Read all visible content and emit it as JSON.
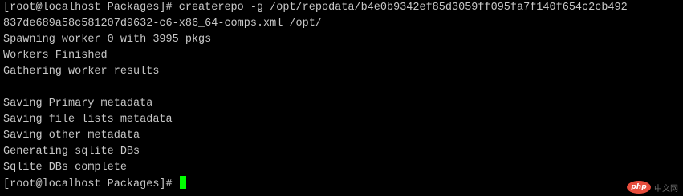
{
  "terminal": {
    "line1": "[root@localhost Packages]# createrepo -g /opt/repodata/b4e0b9342ef85d3059ff095fa7f140f654c2cb492",
    "line2": "837de689a58c581207d9632-c6-x86_64-comps.xml /opt/",
    "line3": "Spawning worker 0 with 3995 pkgs",
    "line4": "Workers Finished",
    "line5": "Gathering worker results",
    "line6": "",
    "line7": "Saving Primary metadata",
    "line8": "Saving file lists metadata",
    "line9": "Saving other metadata",
    "line10": "Generating sqlite DBs",
    "line11": "Sqlite DBs complete",
    "prompt": "[root@localhost Packages]# ",
    "cursor_color": "#00ff00",
    "background_color": "#000000",
    "text_color": "#c8c8c8"
  },
  "watermark": {
    "logo_text": "php",
    "site_text": "中文网",
    "logo_color": "#e74c3c"
  }
}
